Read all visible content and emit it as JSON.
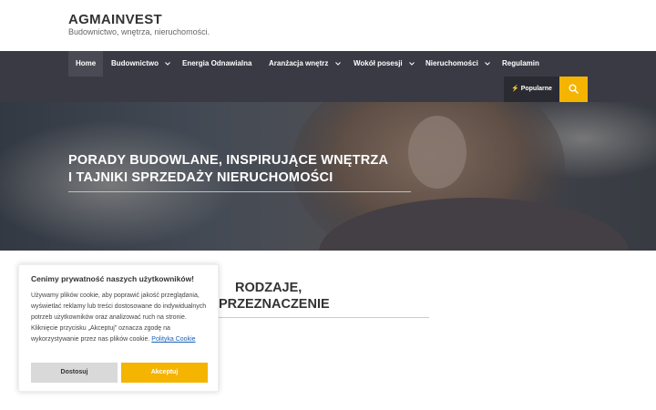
{
  "header": {
    "title": "AGMAINVEST",
    "tagline": "Budownictwo, wnętrza, nieruchomości."
  },
  "nav": {
    "items": [
      {
        "label": "Home",
        "active": true,
        "has_dropdown": false
      },
      {
        "label": "Budownictwo",
        "active": false,
        "has_dropdown": true
      },
      {
        "label": "Energia Odnawialna",
        "active": false,
        "has_dropdown": false
      },
      {
        "label": "Aranżacja wnętrz",
        "active": false,
        "has_dropdown": true
      },
      {
        "label": "Wokół posesji",
        "active": false,
        "has_dropdown": true
      },
      {
        "label": "Nieruchomości",
        "active": false,
        "has_dropdown": true
      },
      {
        "label": "Regulamin",
        "active": false,
        "has_dropdown": false
      }
    ],
    "popular_label": "⚡ Popularne",
    "search_icon": "search-icon"
  },
  "hero": {
    "title_line1": "PORADY BUDOWLANE, INSPIRUJĄCE WNĘTRZA",
    "title_line2": "I TAJNIKI SPRZEDAŻY NIERUCHOMOŚCI"
  },
  "post": {
    "title_line1": "RODZAJE,",
    "title_line2": "PRZEZNACZENIE"
  },
  "cookie": {
    "title": "Cenimy prywatność naszych użytkowników!",
    "text": "Używamy plików cookie, aby poprawić jakość przeglądania, wyświetlać reklamy lub treści dostosowane do indywidualnych potrzeb użytkowników oraz analizować ruch na stronie. Kliknięcie przycisku „Akceptuj” oznacza zgodę na wykorzystywanie przez nas plików cookie.",
    "link": "Polityka Cookie",
    "reject": "Dostosuj",
    "accept": "Akceptuj"
  },
  "colors": {
    "accent": "#f4b400",
    "nav_bg": "#3a3a45",
    "link": "#1a5fb4"
  }
}
